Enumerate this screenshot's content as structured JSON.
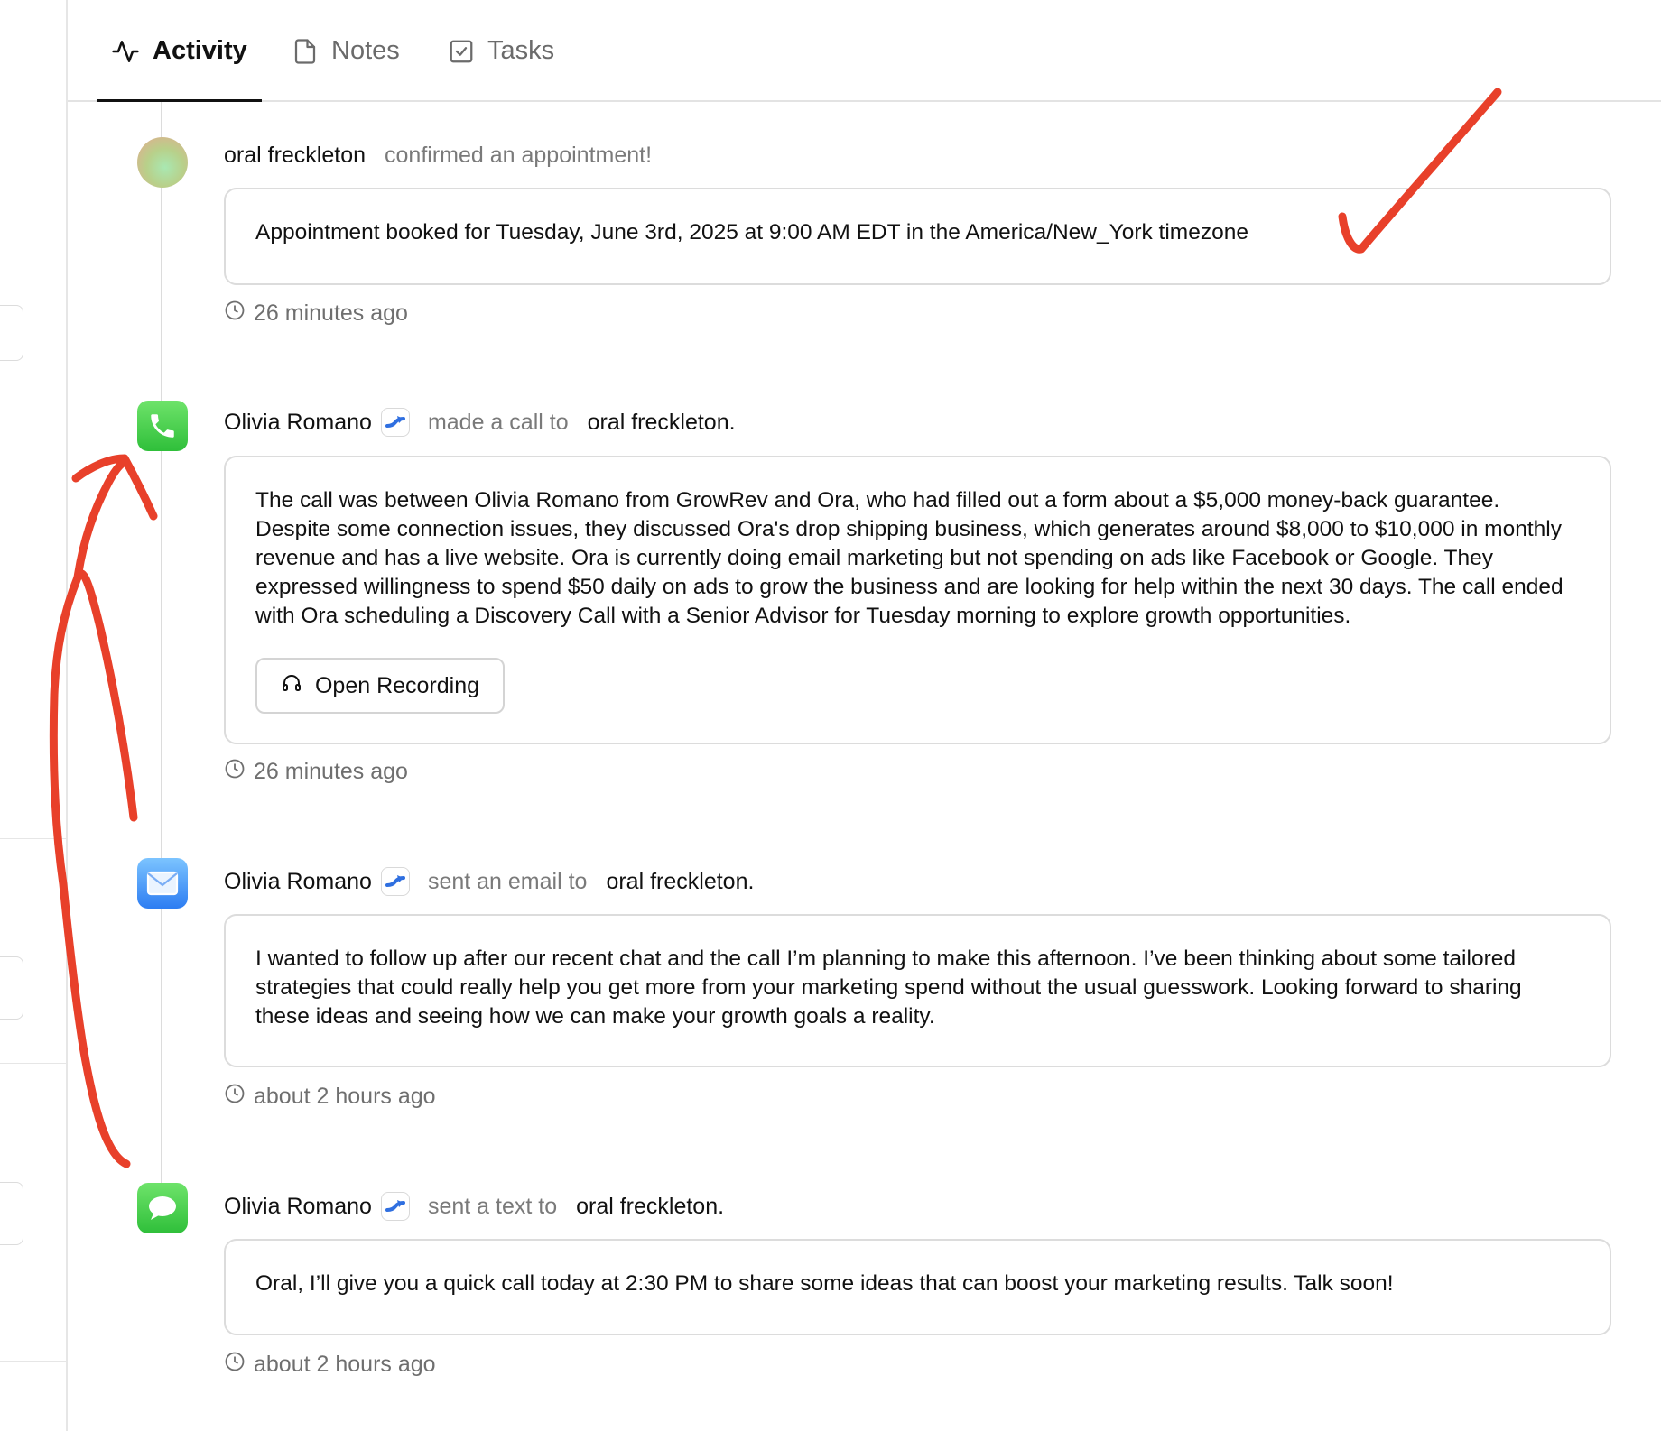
{
  "tabs": [
    {
      "label": "Activity",
      "icon": "activity-icon",
      "active": true
    },
    {
      "label": "Notes",
      "icon": "notes-icon",
      "active": false
    },
    {
      "label": "Tasks",
      "icon": "tasks-icon",
      "active": false
    }
  ],
  "entries": [
    {
      "type": "appointment",
      "icon": "avatar",
      "actor": "oral freckleton",
      "verb": "confirmed an appointment!",
      "body": "Appointment booked for Tuesday, June 3rd, 2025 at 9:00 AM EDT in the America/New_York timezone",
      "timestamp": "26 minutes ago"
    },
    {
      "type": "call",
      "icon": "phone-icon",
      "actor": "Olivia Romano",
      "verb": "made a call to",
      "target": "oral freckleton.",
      "body": "The call was between Olivia Romano from GrowRev and Ora, who had filled out a form about a $5,000 money-back guarantee. Despite some connection issues, they discussed Ora's drop shipping business, which generates around $8,000 to $10,000 in monthly revenue and has a live website. Ora is currently doing email marketing but not spending on ads like Facebook or Google. They expressed willingness to spend $50 daily on ads to grow the business and are looking for help within the next 30 days. The call ended with Ora scheduling a Discovery Call with a Senior Advisor for Tuesday morning to explore growth opportunities.",
      "button_label": "Open Recording",
      "timestamp": "26 minutes ago"
    },
    {
      "type": "email",
      "icon": "mail-icon",
      "actor": "Olivia Romano",
      "verb": "sent an email to",
      "target": "oral freckleton.",
      "body": "I wanted to follow up after our recent chat and the call I’m planning to make this afternoon. I’ve been thinking about some tailored strategies that could really help you get more from your marketing spend without the usual guesswork. Looking forward to sharing these ideas and seeing how we can make your growth goals a reality.",
      "timestamp": "about 2 hours ago"
    },
    {
      "type": "text",
      "icon": "message-icon",
      "actor": "Olivia Romano",
      "verb": "sent a text to",
      "target": "oral freckleton.",
      "body": "Oral, I’ll give you a quick call today at 2:30 PM to share some ideas that can boost your marketing results. Talk soon!",
      "timestamp": "about 2 hours ago"
    }
  ],
  "colors": {
    "annotation": "#e8402a",
    "muted_text": "#7a7a7a",
    "border": "#dcdcdc"
  }
}
